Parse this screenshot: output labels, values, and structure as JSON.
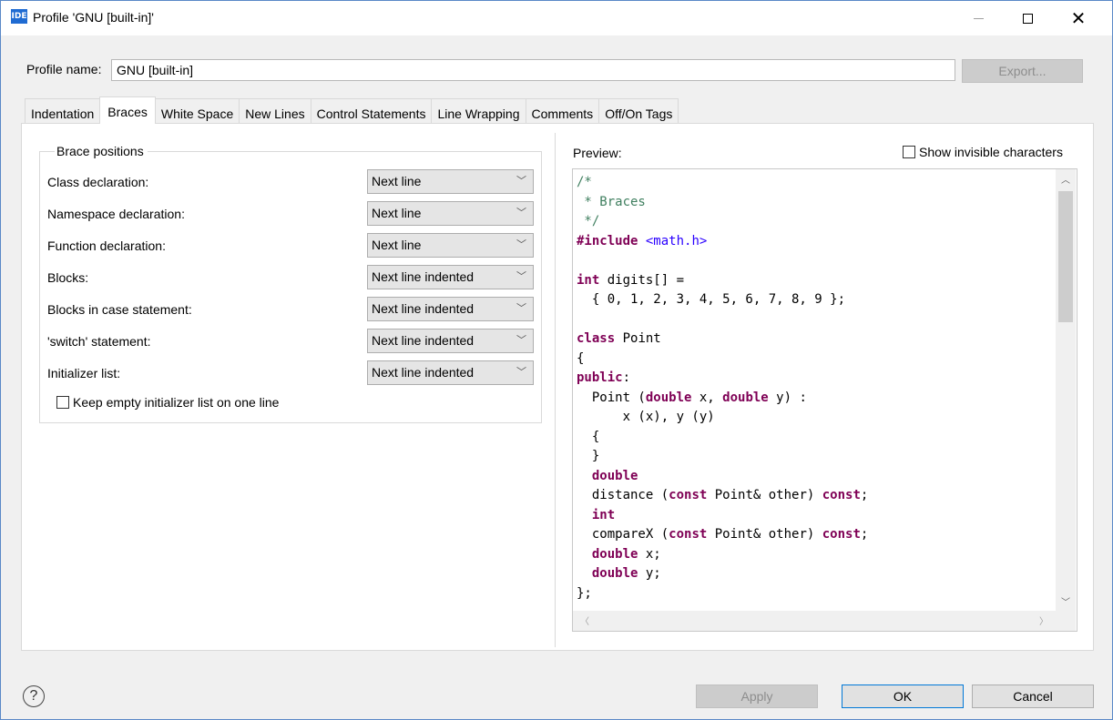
{
  "window": {
    "title": "Profile 'GNU [built-in]'",
    "icon_label": "IDE",
    "close_glyph": "✕"
  },
  "profile": {
    "label": "Profile name:",
    "value": "GNU [built-in]",
    "export_label": "Export..."
  },
  "tabs": [
    {
      "label": "Indentation"
    },
    {
      "label": "Braces"
    },
    {
      "label": "White Space"
    },
    {
      "label": "New Lines"
    },
    {
      "label": "Control Statements"
    },
    {
      "label": "Line Wrapping"
    },
    {
      "label": "Comments"
    },
    {
      "label": "Off/On Tags"
    }
  ],
  "active_tab": "Braces",
  "brace_positions": {
    "title": "Brace positions",
    "rows": [
      {
        "label": "Class declaration:",
        "value": "Next line"
      },
      {
        "label": "Namespace declaration:",
        "value": "Next line"
      },
      {
        "label": "Function declaration:",
        "value": "Next line"
      },
      {
        "label": "Blocks:",
        "value": "Next line indented"
      },
      {
        "label": "Blocks in case statement:",
        "value": "Next line indented"
      },
      {
        "label": "'switch' statement:",
        "value": "Next line indented"
      },
      {
        "label": "Initializer list:",
        "value": "Next line indented"
      }
    ],
    "keep_empty_label": "Keep empty initializer list on one line",
    "keep_empty_checked": false
  },
  "preview": {
    "label": "Preview:",
    "show_invisible_label": "Show invisible characters",
    "show_invisible_checked": false,
    "code_lines": [
      [
        {
          "t": "/*",
          "s": "c"
        }
      ],
      [
        {
          "t": " * Braces",
          "s": "c"
        }
      ],
      [
        {
          "t": " */",
          "s": "c"
        }
      ],
      [
        {
          "t": "#include",
          "s": "k"
        },
        {
          "t": " ",
          "s": ""
        },
        {
          "t": "<math.h>",
          "s": "i"
        }
      ],
      [
        {
          "t": "",
          "s": ""
        }
      ],
      [
        {
          "t": "int",
          "s": "k"
        },
        {
          "t": " digits[] =",
          "s": ""
        }
      ],
      [
        {
          "t": "  { 0, 1, 2, 3, 4, 5, 6, 7, 8, 9 };",
          "s": ""
        }
      ],
      [
        {
          "t": "",
          "s": ""
        }
      ],
      [
        {
          "t": "class",
          "s": "k"
        },
        {
          "t": " Point",
          "s": ""
        }
      ],
      [
        {
          "t": "{",
          "s": ""
        }
      ],
      [
        {
          "t": "public",
          "s": "k"
        },
        {
          "t": ":",
          "s": ""
        }
      ],
      [
        {
          "t": "  Point (",
          "s": ""
        },
        {
          "t": "double",
          "s": "k"
        },
        {
          "t": " x, ",
          "s": ""
        },
        {
          "t": "double",
          "s": "k"
        },
        {
          "t": " y) :",
          "s": ""
        }
      ],
      [
        {
          "t": "      x (x), y (y)",
          "s": ""
        }
      ],
      [
        {
          "t": "  {",
          "s": ""
        }
      ],
      [
        {
          "t": "  }",
          "s": ""
        }
      ],
      [
        {
          "t": "  ",
          "s": ""
        },
        {
          "t": "double",
          "s": "k"
        }
      ],
      [
        {
          "t": "  distance (",
          "s": ""
        },
        {
          "t": "const",
          "s": "k"
        },
        {
          "t": " Point& other) ",
          "s": ""
        },
        {
          "t": "const",
          "s": "k"
        },
        {
          "t": ";",
          "s": ""
        }
      ],
      [
        {
          "t": "  ",
          "s": ""
        },
        {
          "t": "int",
          "s": "k"
        }
      ],
      [
        {
          "t": "  compareX (",
          "s": ""
        },
        {
          "t": "const",
          "s": "k"
        },
        {
          "t": " Point& other) ",
          "s": ""
        },
        {
          "t": "const",
          "s": "k"
        },
        {
          "t": ";",
          "s": ""
        }
      ],
      [
        {
          "t": "  ",
          "s": ""
        },
        {
          "t": "double",
          "s": "k"
        },
        {
          "t": " x;",
          "s": ""
        }
      ],
      [
        {
          "t": "  ",
          "s": ""
        },
        {
          "t": "double",
          "s": "k"
        },
        {
          "t": " y;",
          "s": ""
        }
      ],
      [
        {
          "t": "};",
          "s": ""
        }
      ]
    ]
  },
  "buttons": {
    "help_glyph": "?",
    "apply": "Apply",
    "ok": "OK",
    "cancel": "Cancel"
  },
  "colors": {
    "comment": "#3f7f5f",
    "keyword": "#7f0055",
    "include_path": "#2a00ff",
    "ok_border": "#0078d7"
  }
}
